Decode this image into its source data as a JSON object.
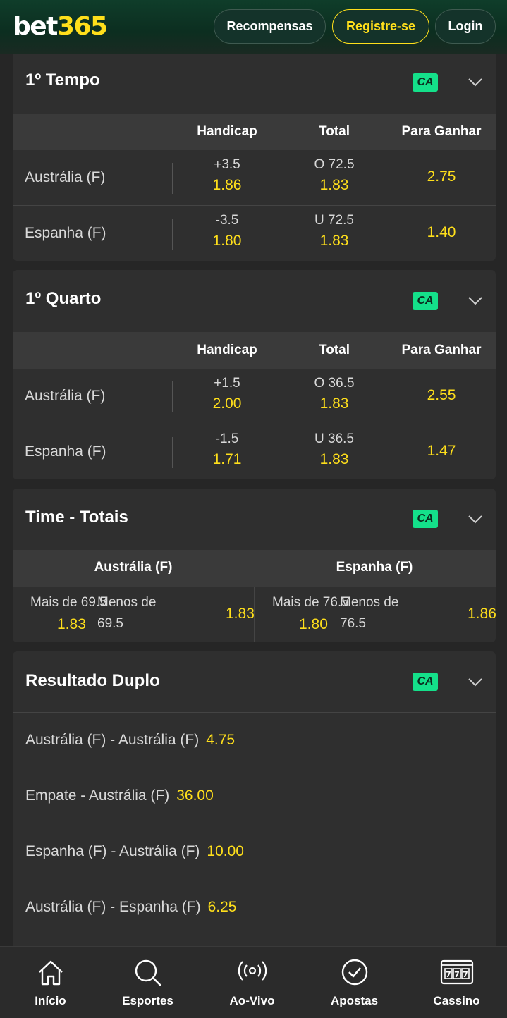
{
  "header": {
    "logo_part1": "bet",
    "logo_part2": "365",
    "rewards_label": "Recompensas",
    "register_label": "Registre-se",
    "login_label": "Login"
  },
  "markets": {
    "first_half": {
      "title": "1º Tempo",
      "badge": "CA",
      "columns": [
        "Handicap",
        "Total",
        "Para Ganhar"
      ],
      "rows": [
        {
          "team": "Austrália (F)",
          "hcp_line": "+3.5",
          "hcp_odd": "1.86",
          "tot_line": "O 72.5",
          "tot_odd": "1.83",
          "win_odd": "2.75"
        },
        {
          "team": "Espanha (F)",
          "hcp_line": "-3.5",
          "hcp_odd": "1.80",
          "tot_line": "U 72.5",
          "tot_odd": "1.83",
          "win_odd": "1.40"
        }
      ]
    },
    "first_quarter": {
      "title": "1º Quarto",
      "badge": "CA",
      "columns": [
        "Handicap",
        "Total",
        "Para Ganhar"
      ],
      "rows": [
        {
          "team": "Austrália (F)",
          "hcp_line": "+1.5",
          "hcp_odd": "2.00",
          "tot_line": "O 36.5",
          "tot_odd": "1.83",
          "win_odd": "2.55"
        },
        {
          "team": "Espanha (F)",
          "hcp_line": "-1.5",
          "hcp_odd": "1.71",
          "tot_line": "U 36.5",
          "tot_odd": "1.83",
          "win_odd": "1.47"
        }
      ]
    },
    "team_totals": {
      "title": "Time - Totais",
      "badge": "CA",
      "teams": [
        {
          "name": "Austrália (F)",
          "over_label": "Mais de 69.5",
          "over_odd": "1.83",
          "under_label": "Menos de",
          "under_value": "69.5",
          "under_odd": "1.83"
        },
        {
          "name": "Espanha (F)",
          "over_label": "Mais de 76.5",
          "over_odd": "1.80",
          "under_label": "Menos de",
          "under_value": "76.5",
          "under_odd": "1.86"
        }
      ]
    },
    "double_result": {
      "title": "Resultado Duplo",
      "badge": "CA",
      "items": [
        {
          "label": "Austrália (F) - Austrália (F)",
          "odd": "4.75"
        },
        {
          "label": "Empate - Austrália (F)",
          "odd": "36.00"
        },
        {
          "label": "Espanha (F) - Austrália (F)",
          "odd": "10.00"
        },
        {
          "label": "Austrália (F) - Espanha (F)",
          "odd": "6.25"
        }
      ]
    }
  },
  "nav": {
    "items": [
      {
        "label": "Início",
        "icon": "home-icon"
      },
      {
        "label": "Esportes",
        "icon": "search-icon"
      },
      {
        "label": "Ao-Vivo",
        "icon": "live-icon"
      },
      {
        "label": "Apostas",
        "icon": "check-icon"
      },
      {
        "label": "Cassino",
        "icon": "slots-icon"
      }
    ]
  },
  "colors": {
    "accent_yellow": "#ffdf1b",
    "badge_green": "#14e08a",
    "card_bg": "#2f2f2f",
    "header_bg": "#0f3d2a"
  }
}
